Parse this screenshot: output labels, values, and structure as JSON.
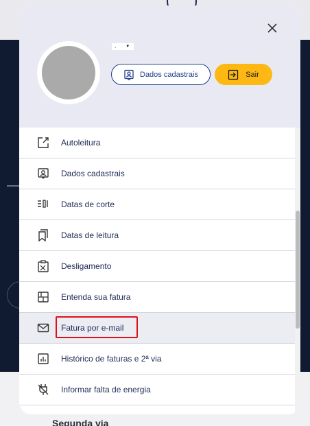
{
  "background": {
    "bottom_text": "Segunda via"
  },
  "modal": {
    "close_icon": "close-icon",
    "user": {
      "name_text": "."
    },
    "buttons": {
      "dados_label": "Dados cadastrais",
      "sair_label": "Sair"
    },
    "menu_items": [
      {
        "label": "Autoleitura",
        "icon": "edit-icon"
      },
      {
        "label": "Dados cadastrais",
        "icon": "id-card-icon"
      },
      {
        "label": "Datas de corte",
        "icon": "cut-dates-icon"
      },
      {
        "label": "Datas de leitura",
        "icon": "reading-dates-icon"
      },
      {
        "label": "Desligamento",
        "icon": "clipboard-icon"
      },
      {
        "label": "Entenda sua fatura",
        "icon": "layout-icon"
      },
      {
        "label": "Fatura por e-mail",
        "icon": "mail-icon"
      },
      {
        "label": "Histórico de faturas e 2ª via",
        "icon": "chart-icon"
      },
      {
        "label": "Informar falta de energia",
        "icon": "no-power-icon"
      }
    ]
  },
  "colors": {
    "accent_blue": "#1e3f8a",
    "sair_yellow": "#fdb813",
    "highlight_red": "#e0101a"
  }
}
